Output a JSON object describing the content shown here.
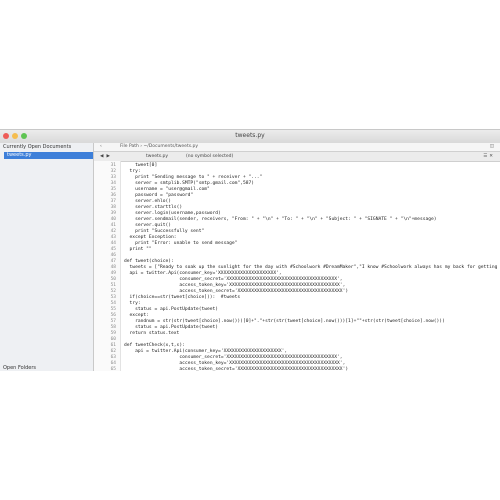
{
  "window": {
    "title": "tweets.py"
  },
  "sidebar": {
    "header": "Currently Open Documents",
    "items": [
      {
        "label": "tweets.py"
      }
    ],
    "footer": "Open Folders"
  },
  "pathbar": {
    "path": "File Path › ~/Documents/tweets.py"
  },
  "tabbar": {
    "file_label": "tweets.py",
    "symbol_label": "(no symbol selected)"
  },
  "editor": {
    "lines": [
      {
        "number": "31",
        "indent": 4,
        "text": "tweet[0]"
      },
      {
        "number": "32",
        "indent": 2,
        "text": "try:"
      },
      {
        "number": "33",
        "indent": 4,
        "text": "print \"Sending message to \" + receiver + \"...\""
      },
      {
        "number": "34",
        "indent": 4,
        "text": "server = smtplib.SMTP(\"smtp.gmail.com\",587)"
      },
      {
        "number": "35",
        "indent": 4,
        "text": "username = \"user@gmail.com\""
      },
      {
        "number": "36",
        "indent": 4,
        "text": "password = \"password\""
      },
      {
        "number": "37",
        "indent": 4,
        "text": "server.ehlo()"
      },
      {
        "number": "38",
        "indent": 4,
        "text": "server.starttls()"
      },
      {
        "number": "39",
        "indent": 4,
        "text": "server.login(username,password)"
      },
      {
        "number": "40",
        "indent": 4,
        "text": "server.sendmail(sender, receivers, \"From: \" + \"\\n\" + \"To: \" + \"\\n\" + \"Subject: \" + \"SIGNATE \" + \"\\n\"+message)"
      },
      {
        "number": "41",
        "indent": 4,
        "text": "server.quit()"
      },
      {
        "number": "42",
        "indent": 4,
        "text": "print \"Successfully sent\""
      },
      {
        "number": "43",
        "indent": 2,
        "text": "except Exception:"
      },
      {
        "number": "44",
        "indent": 4,
        "text": "print \"Error: unable to send message\""
      },
      {
        "number": "45",
        "indent": 2,
        "text": "print \"\""
      },
      {
        "number": "46",
        "indent": 0,
        "text": ""
      },
      {
        "number": "47",
        "indent": 0,
        "text": "def tweet(choice):"
      },
      {
        "number": "48",
        "indent": 2,
        "text": "tweets = [\"Ready to soak up the sunlight for the day with #Schoolwork #DreamMaker\",\"I know #Schoolwork always has my back for getting"
      },
      {
        "number": "49",
        "indent": 2,
        "text": "api = twitter.Api(consumer_key='XXXXXXXXXXXXXXXXXXXXX',"
      },
      {
        "number": "50",
        "indent": 20,
        "text": "consumer_secret='XXXXXXXXXXXXXXXXXXXXXXXXXXXXXXXXXXXXXXXX',"
      },
      {
        "number": "51",
        "indent": 20,
        "text": "access_token_key='XXXXXXXXXXXXXXXXXXXXXXXXXXXXXXXXXXXXXXXX',"
      },
      {
        "number": "52",
        "indent": 20,
        "text": "access_token_secret='XXXXXXXXXXXXXXXXXXXXXXXXXXXXXXXXXXXXXX')"
      },
      {
        "number": "53",
        "indent": 2,
        "text": "if(choice==str(tweet[choice])):  #tweets"
      },
      {
        "number": "54",
        "indent": 2,
        "text": "try:"
      },
      {
        "number": "55",
        "indent": 4,
        "text": "status = api.PostUpdate(tweet)"
      },
      {
        "number": "56",
        "indent": 2,
        "text": "except:"
      },
      {
        "number": "57",
        "indent": 4,
        "text": "randnum = str(str(tweet[choice].now()))[0]+\".\"+str(str(tweet[choice].now()))[1]+\"\"+str(str(tweet[choice].now()))"
      },
      {
        "number": "58",
        "indent": 4,
        "text": "status = api.PostUpdate(tweet)"
      },
      {
        "number": "59",
        "indent": 2,
        "text": "return status.text"
      },
      {
        "number": "60",
        "indent": 0,
        "text": ""
      },
      {
        "number": "61",
        "indent": 0,
        "text": "def tweetCheck(x,t,s):"
      },
      {
        "number": "62",
        "indent": 4,
        "text": "api = twitter.Api(consumer_key='XXXXXXXXXXXXXXXXXXXXX',"
      },
      {
        "number": "63",
        "indent": 20,
        "text": "consumer_secret='XXXXXXXXXXXXXXXXXXXXXXXXXXXXXXXXXXXXXXXX',"
      },
      {
        "number": "64",
        "indent": 20,
        "text": "access_token_key='XXXXXXXXXXXXXXXXXXXXXXXXXXXXXXXXXXXXXXXX',"
      },
      {
        "number": "65",
        "indent": 20,
        "text": "access_token_secret='XXXXXXXXXXXXXXXXXXXXXXXXXXXXXXXXXXXXXX')"
      }
    ]
  }
}
